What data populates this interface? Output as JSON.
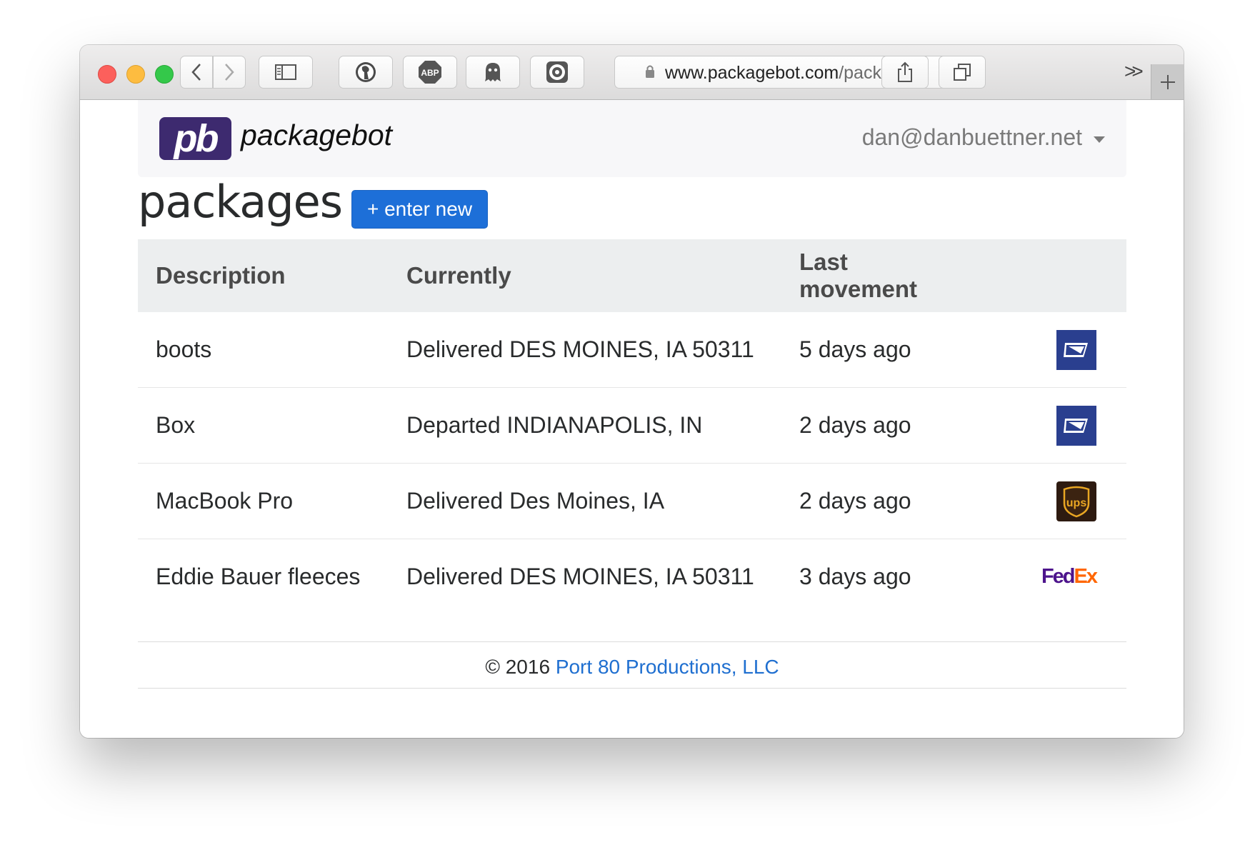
{
  "browser": {
    "url_host": "www.packagebot.com",
    "url_path": "/packages",
    "extensions": [
      "duckduckgo-icon",
      "adblock-plus-icon",
      "ghostery-icon",
      "camera-lens-icon"
    ],
    "abp_label": "ABP"
  },
  "nav": {
    "logo_text": "pb",
    "brand_name": "packagebot",
    "user_email": "dan@danbuettner.net"
  },
  "page": {
    "title": "packages",
    "new_button": "+ enter new"
  },
  "table": {
    "headers": [
      "Description",
      "Currently",
      "Last movement"
    ],
    "rows": [
      {
        "description": "boots",
        "currently": "Delivered DES MOINES, IA 50311",
        "last_movement": "5 days ago",
        "carrier": "usps"
      },
      {
        "description": "Box",
        "currently": "Departed INDIANAPOLIS, IN",
        "last_movement": "2 days ago",
        "carrier": "usps"
      },
      {
        "description": "MacBook Pro",
        "currently": "Delivered Des Moines, IA",
        "last_movement": "2 days ago",
        "carrier": "ups"
      },
      {
        "description": "Eddie Bauer fleeces",
        "currently": "Delivered DES MOINES, IA 50311",
        "last_movement": "3 days ago",
        "carrier": "fedex"
      }
    ],
    "carrier_logos": {
      "ups": "ups",
      "fedex_fe": "Fed",
      "fedex_ex": "Ex"
    }
  },
  "footer": {
    "copyright": "© 2016",
    "company_link": "Port 80 Productions, LLC"
  },
  "colors": {
    "primary": "#1d6fd8",
    "logo_purple": "#3d2a6f",
    "usps_blue": "#2a3f8f",
    "ups_brown": "#2d1a10",
    "fedex_purple": "#4d148c",
    "fedex_orange": "#ff6600"
  }
}
